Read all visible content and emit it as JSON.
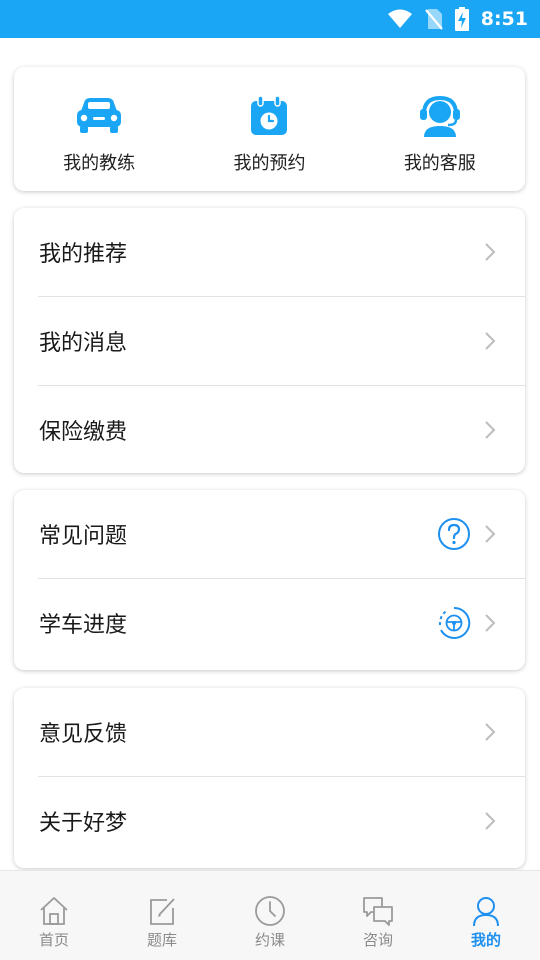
{
  "status_bar": {
    "time": "8:51"
  },
  "quick_actions": [
    {
      "label": "我的教练",
      "icon": "car-icon"
    },
    {
      "label": "我的预约",
      "icon": "calendar-clock-icon"
    },
    {
      "label": "我的客服",
      "icon": "customer-service-icon"
    }
  ],
  "group1": {
    "items": [
      {
        "label": "我的推荐"
      },
      {
        "label": "我的消息"
      },
      {
        "label": "保险缴费"
      }
    ]
  },
  "group2": {
    "items": [
      {
        "label": "常见问题",
        "icon": "question-circle-icon"
      },
      {
        "label": "学车进度",
        "icon": "steering-wheel-progress-icon"
      }
    ]
  },
  "group3": {
    "items": [
      {
        "label": "意见反馈"
      },
      {
        "label": "关于好梦"
      }
    ]
  },
  "tabbar": {
    "active": "我的",
    "tabs": [
      {
        "label": "首页",
        "icon": "home-icon"
      },
      {
        "label": "题库",
        "icon": "edit-icon"
      },
      {
        "label": "约课",
        "icon": "clock-icon"
      },
      {
        "label": "咨询",
        "icon": "chat-icon"
      },
      {
        "label": "我的",
        "icon": "user-icon"
      }
    ]
  },
  "colors": {
    "accent": "#1e90f0",
    "status_bar": "#1aa6f4",
    "icon_blue": "#1aa6f4"
  }
}
